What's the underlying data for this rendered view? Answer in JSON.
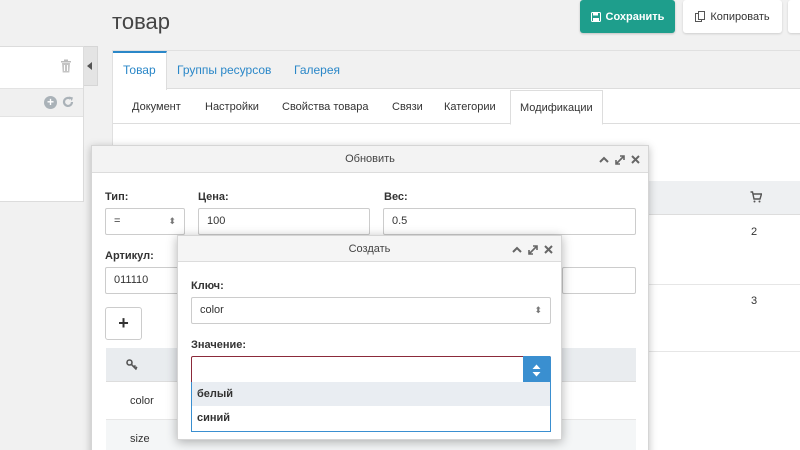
{
  "page": {
    "title": "товар"
  },
  "toolbar": {
    "save_label": "Сохранить",
    "copy_label": "Копировать"
  },
  "main_tabs": [
    "Товар",
    "Группы ресурсов",
    "Галерея"
  ],
  "sub_tabs": [
    "Документ",
    "Настройки",
    "Свойства товара",
    "Связи",
    "Категории",
    "Модификации"
  ],
  "bg_table": {
    "values": [
      "2",
      "3"
    ]
  },
  "update_dialog": {
    "title": "Обновить",
    "type_label": "Тип:",
    "type_value": "=",
    "price_label": "Цена:",
    "price_value": "100",
    "weight_label": "Вес:",
    "weight_value": "0.5",
    "article_label": "Артикул:",
    "article_value": "011110",
    "add_symbol": "+",
    "rows": [
      "color",
      "size"
    ]
  },
  "create_dialog": {
    "title": "Создать",
    "key_label": "Ключ:",
    "key_value": "color",
    "value_label": "Значение:",
    "value_value": "",
    "options": [
      "белый",
      "синий"
    ]
  },
  "colors": {
    "accent_green": "#1e9e8c",
    "link_blue": "#2a87c8",
    "select_blue": "#3a8fd0"
  }
}
